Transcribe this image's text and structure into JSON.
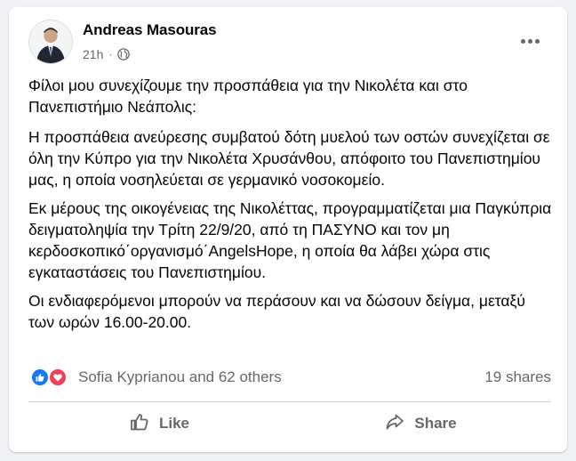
{
  "post": {
    "author": "Andreas Masouras",
    "time": "21h",
    "separator": "·",
    "privacy_icon": "globe-icon",
    "more_icon": "more-options-icon",
    "paragraphs": [
      "Φίλοι μου συνεχίζουμε την προσπάθεια για την Νικολέτα και στο Πανεπιστήμιο Νεάπολις:",
      "Η προσπάθεια ανεύρεσης συμβατού δότη μυελού των οστών συνεχίζεται σε όλη την Κύπρο για την Νικολέτα Χρυσάνθου, απόφοιτο του Πανεπιστημίου μας, η οποία νοσηλεύεται σε γερμανικό νοσοκομείο.",
      "Εκ μέρους της οικογένειας της Νικολέττας, προγραμματίζεται μια Παγκύπρια δειγματοληψία την Τρίτη  22/9/20, από τη ΠΑΣΥΝΟ και τον μη κερδοσκοπικό΄οργανισμό΄AngelsHope, η οποία θα λάβει χώρα στις εγκαταστάσεις του Πανεπιστημίου.",
      "Οι ενδιαφερόμενοι μπορούν να περάσουν και να δώσουν δείγμα, μεταξύ των ωρών 16.00-20.00."
    ]
  },
  "reactions": {
    "icons": [
      "like-reaction-icon",
      "love-reaction-icon"
    ],
    "text": "Sofia Kyprianou and 62 others",
    "shares": "19 shares"
  },
  "actions": {
    "like_label": "Like",
    "share_label": "Share"
  },
  "colors": {
    "like_blue": "#1877f2",
    "love_red": "#f33e58",
    "secondary_text": "#65676b"
  }
}
